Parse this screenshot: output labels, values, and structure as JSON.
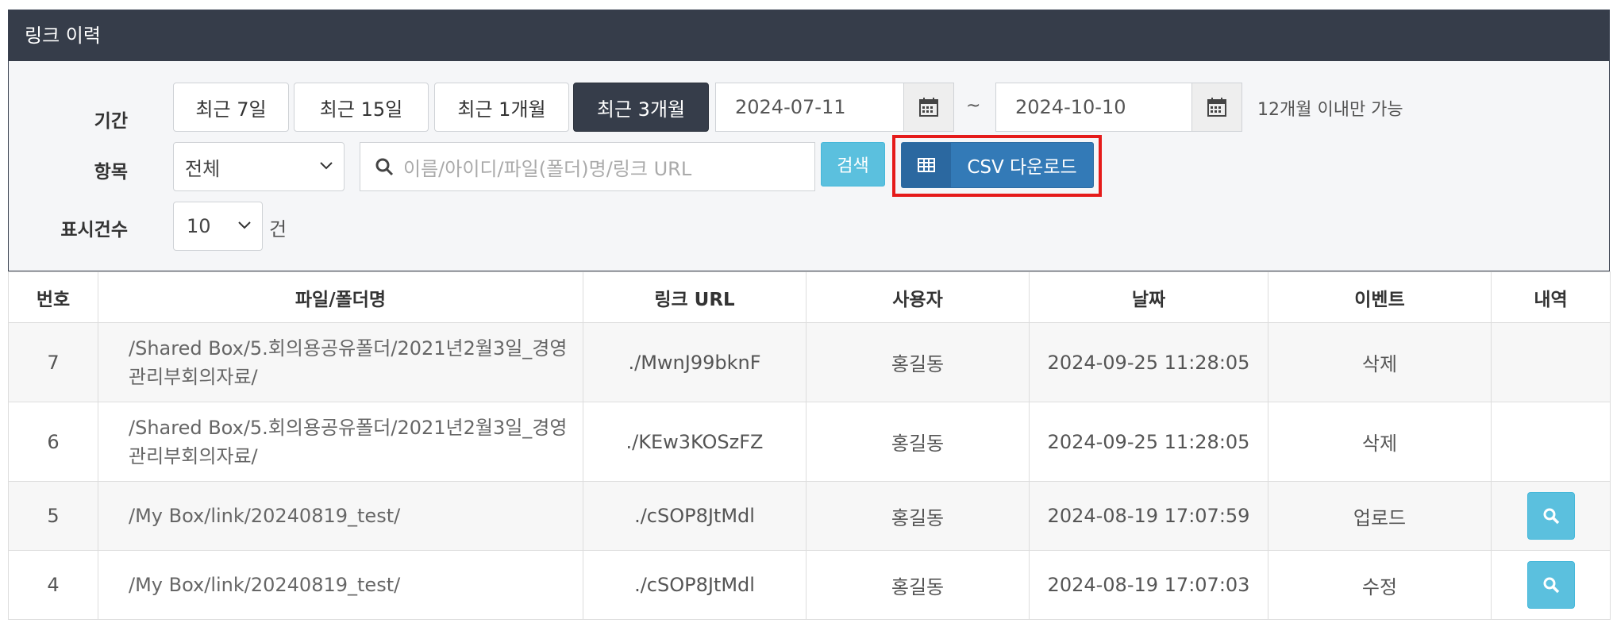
{
  "panel": {
    "title": "링크 이력"
  },
  "filters": {
    "period_label": "기간",
    "period_buttons": [
      "최근 7일",
      "최근 15일",
      "최근 1개월",
      "최근 3개월"
    ],
    "active_period": "최근 3개월",
    "date_from": "2024-07-11",
    "date_sep": "~",
    "date_to": "2024-10-10",
    "date_note": "12개월 이내만 가능",
    "item_label": "항목",
    "item_select": "전체",
    "search_placeholder": "이름/아이디/파일(폴더)명/링크 URL",
    "search_button": "검색",
    "csv_button": "CSV 다운로드",
    "count_label": "표시건수",
    "count_select": "10",
    "count_unit": "건"
  },
  "table": {
    "headers": [
      "번호",
      "파일/폴더명",
      "링크 URL",
      "사용자",
      "날짜",
      "이벤트",
      "내역"
    ],
    "rows": [
      {
        "no": "7",
        "path_line1": "/Shared Box/5.회의용공유폴더/2021년2월3일_경영",
        "path_line2": "관리부회의자료/",
        "url": "./MwnJ99bknF",
        "user": "홍길동",
        "date": "2024-09-25 11:28:05",
        "event": "삭제"
      },
      {
        "no": "6",
        "path_line1": "/Shared Box/5.회의용공유폴더/2021년2월3일_경영",
        "path_line2": "관리부회의자료/",
        "url": "./KEw3KOSzFZ",
        "user": "홍길동",
        "date": "2024-09-25 11:28:05",
        "event": "삭제"
      },
      {
        "no": "5",
        "path_line1": "/My Box/link/20240819_test/",
        "path_line2": "",
        "url": "./cSOP8JtMdl",
        "user": "홍길동",
        "date": "2024-08-19 17:07:59",
        "event": "업로드"
      },
      {
        "no": "4",
        "path_line1": "/My Box/link/20240819_test/",
        "path_line2": "",
        "url": "./cSOP8JtMdl",
        "user": "홍길동",
        "date": "2024-08-19 17:07:03",
        "event": "수정"
      }
    ]
  },
  "icons": {
    "calendar": "calendar-icon",
    "search": "search-icon",
    "grid": "table-icon",
    "chevron": "chevron-down-icon",
    "magnifier": "magnifier-icon"
  },
  "colors": {
    "header_bg": "#363d4a",
    "info_button": "#5bc0de",
    "primary_button": "#337ab7",
    "highlight": "#e51b1b"
  }
}
